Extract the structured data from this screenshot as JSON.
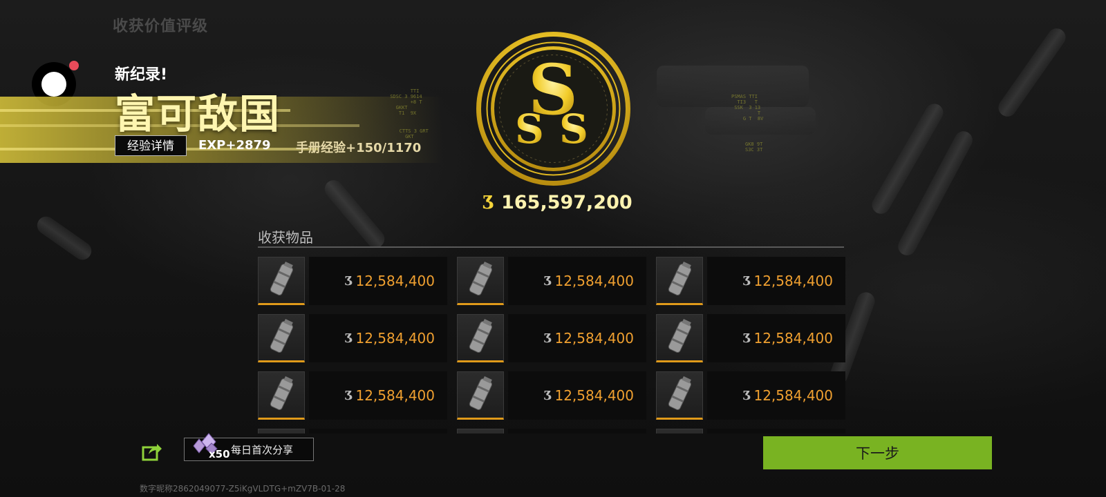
{
  "header": {
    "heading": "收获价值评级"
  },
  "record": {
    "new_record_label": "新纪录!",
    "title": "富可敌国",
    "exp_details_button": "经验详情",
    "exp_value": "EXP+2879",
    "handbook_exp": "手册经验+150/1170"
  },
  "rank": {
    "grade": "SSS",
    "total_value": "165,597,200",
    "coin_glyph": "♪"
  },
  "loot": {
    "section_title": "收获物品",
    "rows": [
      [
        {
          "value": "12,584,400"
        },
        {
          "value": "12,584,400"
        },
        {
          "value": "12,584,400"
        }
      ],
      [
        {
          "value": "12,584,400"
        },
        {
          "value": "12,584,400"
        },
        {
          "value": "12,584,400"
        }
      ],
      [
        {
          "value": "12,584,400"
        },
        {
          "value": "12,584,400"
        },
        {
          "value": "12,584,400"
        }
      ],
      [
        {
          "value": ""
        },
        {
          "value": ""
        },
        {
          "value": ""
        }
      ]
    ]
  },
  "share": {
    "gem_count": "x50",
    "label": "每日首次分享"
  },
  "footer": {
    "next_button": "下一步",
    "watermark": "数字昵称2862049077-Z5iKgVLDTG+mZV7B-01-28"
  },
  "colors": {
    "accent_gold": "#f5d43a",
    "value_orange": "#f0a030",
    "next_green": "#79b322",
    "notification_red": "#e84b5a"
  },
  "icons": {
    "record": "screen-record-icon",
    "share": "share-icon",
    "gem": "gem-icon",
    "coin": "coin-icon",
    "item": "grenade-item-icon"
  }
}
